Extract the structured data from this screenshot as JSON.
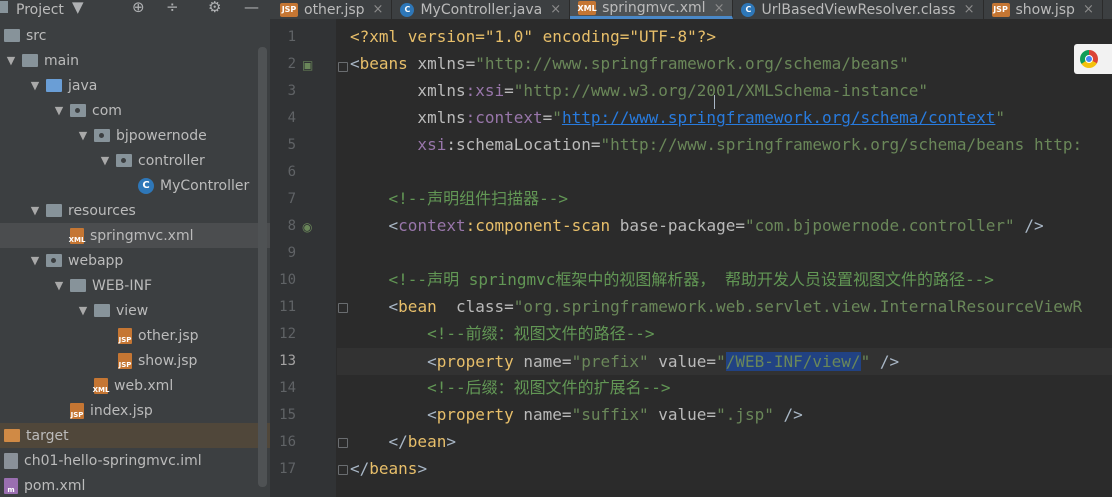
{
  "project_panel": {
    "title": "Project",
    "toolbar_icons": [
      "chevron-down-icon",
      "target-icon",
      "collapse-icon",
      "gear-icon",
      "minimize-icon"
    ]
  },
  "tabs": [
    {
      "label": "other.jsp",
      "icon": "jsp-file-icon",
      "active": false
    },
    {
      "label": "MyController.java",
      "icon": "java-class-icon",
      "active": false
    },
    {
      "label": "springmvc.xml",
      "icon": "xml-file-icon",
      "active": true
    },
    {
      "label": "UrlBasedViewResolver.class",
      "icon": "class-file-icon",
      "active": false
    },
    {
      "label": "show.jsp",
      "icon": "jsp-file-icon",
      "active": false
    }
  ],
  "tree": [
    {
      "label": "src"
    },
    {
      "label": "main"
    },
    {
      "label": "java"
    },
    {
      "label": "com"
    },
    {
      "label": "bjpowernode"
    },
    {
      "label": "controller"
    },
    {
      "label": "MyController"
    },
    {
      "label": "resources"
    },
    {
      "label": "springmvc.xml"
    },
    {
      "label": "webapp"
    },
    {
      "label": "WEB-INF"
    },
    {
      "label": "view"
    },
    {
      "label": "other.jsp"
    },
    {
      "label": "show.jsp"
    },
    {
      "label": "web.xml"
    },
    {
      "label": "index.jsp"
    },
    {
      "label": "target"
    },
    {
      "label": "ch01-hello-springmvc.iml"
    },
    {
      "label": "pom.xml"
    }
  ],
  "editor": {
    "line_numbers": [
      "1",
      "2",
      "3",
      "4",
      "5",
      "6",
      "7",
      "8",
      "9",
      "10",
      "11",
      "12",
      "13",
      "14",
      "15",
      "16",
      "17"
    ],
    "current_line": "13",
    "code": {
      "l1": {
        "a": "<?xml version=\"1.0\" encoding=\"UTF-8\"?>"
      },
      "l2": {
        "a": "<",
        "b": "beans",
        "c": " xmlns=",
        "d": "\"http://www.springframework.org/schema/beans\""
      },
      "l3": {
        "a": "       xmlns",
        "b": ":xsi",
        "c": "=",
        "d": "\"http://www.w3.org/2001/XMLSchema-instance\""
      },
      "l4": {
        "a": "       xmlns",
        "b": ":context",
        "c": "=",
        "d": "\"",
        "e": "http://www.springframework.org/schema/context",
        "f": "\""
      },
      "l5": {
        "a": "       xsi",
        "b": ":schemaLocation",
        "c": "=",
        "d": "\"http://www.springframework.org/schema/beans http:"
      },
      "l7": {
        "a": "    <!--声明组件扫描器-->"
      },
      "l8": {
        "a": "    <",
        "b": "context",
        "c": ":component-scan",
        "d": " base-package=",
        "e": "\"com.bjpowernode.controller\"",
        "f": " />"
      },
      "l10": {
        "a": "    <!--声明 springmvc框架中的视图解析器， 帮助开发人员设置视图文件的路径-->"
      },
      "l11": {
        "a": "    <",
        "b": "bean",
        "c": "  class=",
        "d": "\"org.springframework.web.servlet.view.InternalResourceViewR"
      },
      "l12": {
        "a": "        <!--前缀：视图文件的路径-->"
      },
      "l13": {
        "a": "        <",
        "b": "property",
        "c": " name=",
        "d": "\"prefix\"",
        "e": " value=",
        "f": "\"",
        "g": "/WEB-INF/view/",
        "h": "\"",
        "i": " />"
      },
      "l14": {
        "a": "        <!--后缀：视图文件的扩展名-->"
      },
      "l15": {
        "a": "        <",
        "b": "property",
        "c": " name=",
        "d": "\"suffix\"",
        "e": " value=",
        "f": "\".jsp\"",
        "g": " />"
      },
      "l16": {
        "a": "    </",
        "b": "bean",
        "c": ">"
      },
      "l17": {
        "a": "</",
        "b": "beans",
        "c": ">"
      }
    }
  },
  "overlay": {
    "browser_icon": "chrome-icon"
  }
}
